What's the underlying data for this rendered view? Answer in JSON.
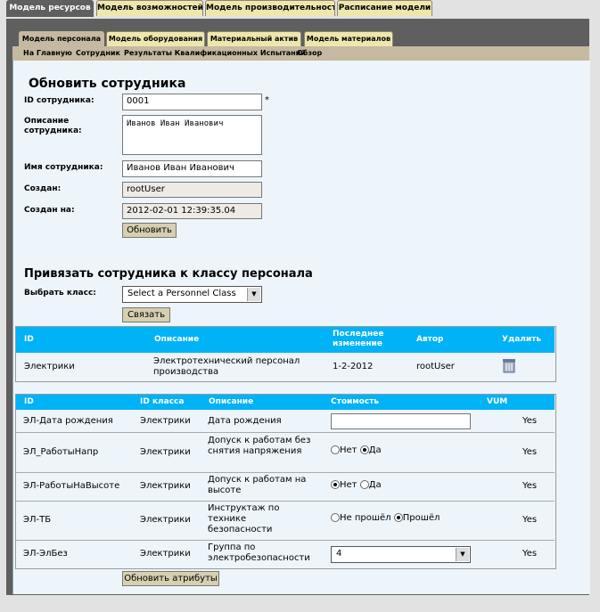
{
  "top_tabs": [
    "Модель ресурсов",
    "Модель возможностей",
    "Модель производительности",
    "Расписание модели"
  ],
  "sub_tabs": [
    "Модель персонала",
    "Модель оборудования",
    "Материальный актив",
    "Модель материалов"
  ],
  "subnav": [
    "На Главную",
    "Сотрудник",
    "Результаты Квалификационных Испытаний",
    "Обзор"
  ],
  "update": {
    "title": "Обновить сотрудника",
    "id_label": "ID сотрудника:",
    "id_value": "0001",
    "required": "*",
    "desc_label": "Описание сотрудника:",
    "desc_value": "Иванов Иван Иванович",
    "name_label": "Имя сотрудника:",
    "name_value": "Иванов Иван Иванович",
    "created_label": "Создан:",
    "created_value": "rootUser",
    "created_at_label": "Создан на:",
    "created_at_value": "2012-02-01 12:39:35.04",
    "button": "Обновить"
  },
  "bind": {
    "title": "Привязать сотрудника к классу персонала",
    "class_label": "Выбрать класс:",
    "class_value": "Select a Personnel Class",
    "button": "Связать"
  },
  "class_table": {
    "headers": [
      "ID",
      "Описание",
      "Последнее изменение",
      "Автор",
      "Удалить"
    ],
    "rows": [
      [
        "Электрики",
        "Электротехнический персонал производства",
        "1-2-2012",
        "rootUser"
      ]
    ]
  },
  "attr_table": {
    "headers": [
      "ID",
      "ID класса",
      "Описание",
      "Стоимость",
      "VUM"
    ],
    "rows": [
      {
        "id": "ЭЛ-Дата рождения",
        "cls": "Электрики",
        "desc": "Дата рождения",
        "vum": "Yes"
      },
      {
        "id": "ЭЛ_РаботыНапр",
        "cls": "Электрики",
        "desc": "Допуск к работам без снятия напряжения",
        "opt1": "Нет",
        "opt2": "Да",
        "vum": "Yes"
      },
      {
        "id": "ЭЛ-РаботыНаВысоте",
        "cls": "Электрики",
        "desc": "Допуск к работам на высоте",
        "opt1": "Нет",
        "opt2": "Да",
        "vum": "Yes"
      },
      {
        "id": "ЭЛ-ТБ",
        "cls": "Электрики",
        "desc": "Инструктаж по технике безопасности",
        "opt1": "Не прошёл",
        "opt2": "Прошёл",
        "vum": "Yes"
      },
      {
        "id": "ЭЛ-ЭлБез",
        "cls": "Электрики",
        "desc": "Группа по электробезопасности",
        "select": "4",
        "vum": "Yes"
      }
    ],
    "button": "Обновить атрибуты"
  }
}
